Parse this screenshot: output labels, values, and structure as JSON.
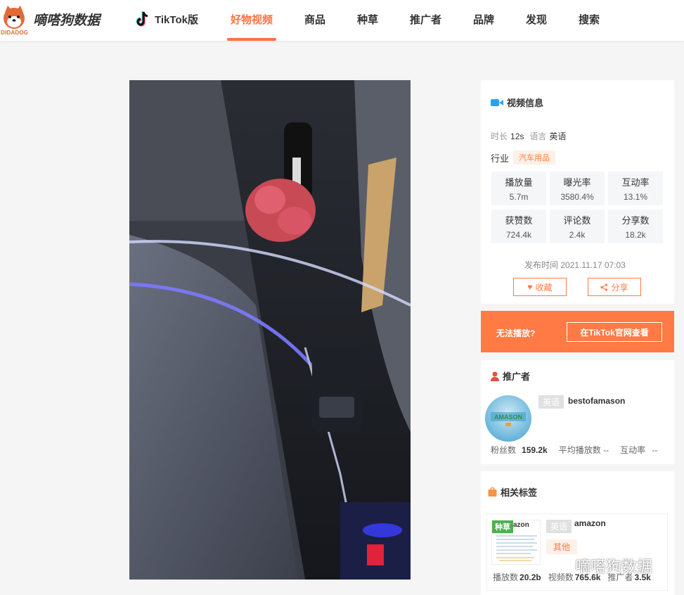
{
  "brand": {
    "name": "嘀嗒狗数据",
    "sub": "DIDADOG"
  },
  "nav": {
    "tiktok": "TikTok版",
    "items": [
      {
        "label": "好物视频",
        "active": true
      },
      {
        "label": "商品"
      },
      {
        "label": "种草"
      },
      {
        "label": "推广者"
      },
      {
        "label": "品牌"
      },
      {
        "label": "发现"
      },
      {
        "label": "搜索"
      }
    ]
  },
  "video_info": {
    "title": "视频信息",
    "duration_label": "时长",
    "duration": "12s",
    "language_label": "语言",
    "language": "英语",
    "industry_label": "行业",
    "industry": "汽车用品",
    "stats": [
      {
        "label": "播放量",
        "value": "5.7m"
      },
      {
        "label": "曝光率",
        "value": "3580.4%"
      },
      {
        "label": "互动率",
        "value": "13.1%"
      },
      {
        "label": "获赞数",
        "value": "724.4k"
      },
      {
        "label": "评论数",
        "value": "2.4k"
      },
      {
        "label": "分享数",
        "value": "18.2k"
      }
    ],
    "publish_label": "发布时间",
    "publish_time": "2021.11.17 07:03",
    "favorite": "收藏",
    "share": "分享"
  },
  "cant_play": {
    "text": "无法播放?",
    "button": "在TikTok官网查看"
  },
  "promoter": {
    "title": "推广者",
    "language": "英语",
    "name": "bestofamason",
    "avatar_text": "AMASON",
    "fans_label": "粉丝数",
    "fans": "159.2k",
    "avg_play_label": "平均播放数",
    "avg_play": "--",
    "interaction_label": "互动率",
    "interaction": "--"
  },
  "tags": {
    "title": "相关标签",
    "badge": "种草",
    "thumb_text": "azon",
    "language": "英语",
    "name": "amazon",
    "category": "其他",
    "play_label": "播放数",
    "play": "20.2b",
    "video_label": "视频数",
    "video": "765.6k",
    "promoter_label": "推广者",
    "promoter": "3.5k"
  },
  "watermark": "嘀嗒狗数据",
  "colors": {
    "accent": "#ff7a45",
    "nav_active": "#ff7043",
    "seed_green": "#4caf50"
  }
}
